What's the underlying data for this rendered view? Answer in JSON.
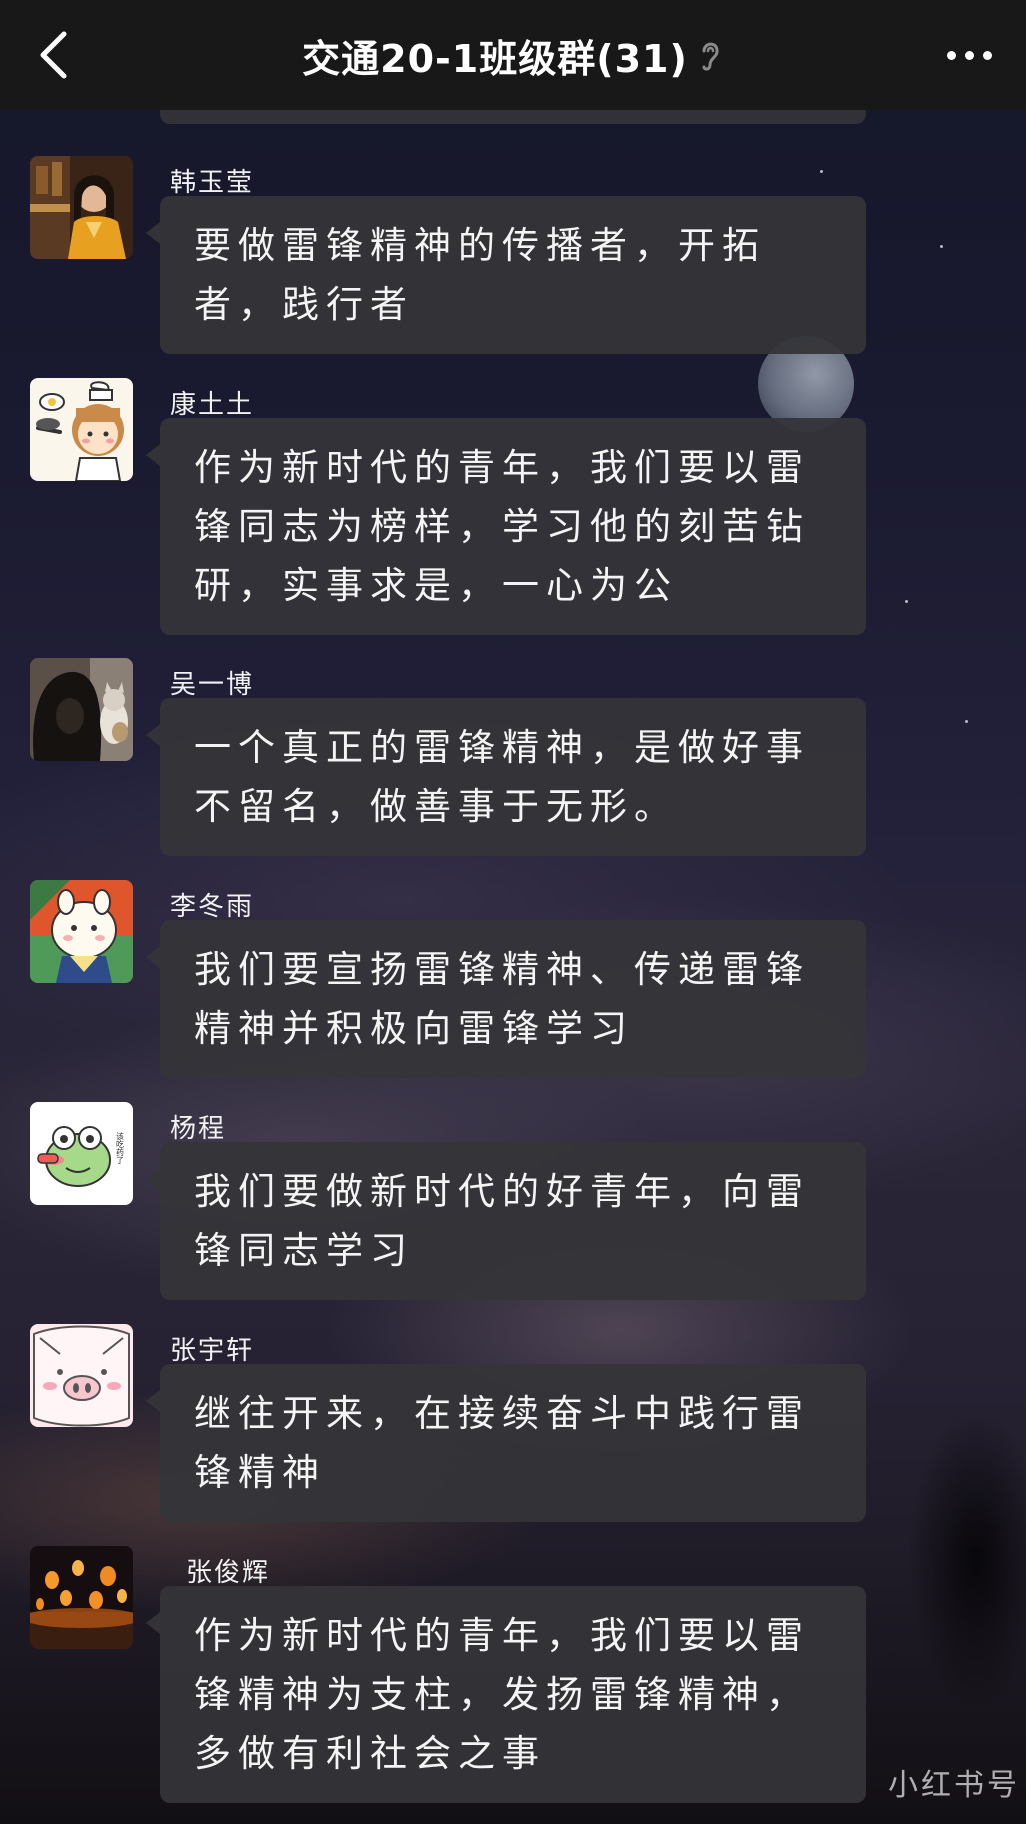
{
  "header": {
    "title": "交通20-1班级群(31)",
    "back_icon": "chevron-left-icon",
    "mute_icon": "ear-icon",
    "more_icon": "more-dots-icon"
  },
  "messages": [
    {
      "sender": "韩玉莹",
      "text": "要做雷锋精神的传播者，开拓者，践行者"
    },
    {
      "sender": "康土土",
      "text": "作为新时代的青年，我们要以雷锋同志为榜样，学习他的刻苦钻研，实事求是，一心为公"
    },
    {
      "sender": "吴一博",
      "text": "一个真正的雷锋精神，是做好事不留名，做善事于无形。"
    },
    {
      "sender": "李冬雨",
      "text": "我们要宣扬雷锋精神、传递雷锋精神并积极向雷锋学习"
    },
    {
      "sender": "杨程",
      "text": "我们要做新时代的好青年，向雷锋同志学习"
    },
    {
      "sender": "张宇轩",
      "text": "继往开来，在接续奋斗中践行雷锋精神"
    },
    {
      "sender": "张俊辉",
      "text": "作为新时代的青年，我们要以雷锋精神为支柱，发扬雷锋精神，多做有利社会之事"
    }
  ],
  "avatar_texts": {
    "yangcheng": "该吃药了"
  },
  "watermark": "小红书号",
  "colors": {
    "topbar": "#181818",
    "bubble": "#343438",
    "text": "#f4f4f4"
  }
}
